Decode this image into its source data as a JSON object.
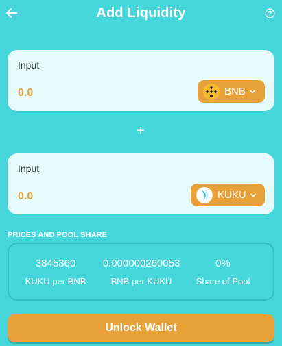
{
  "header": {
    "title": "Add Liquidity",
    "back_icon": "arrow-left-icon",
    "help_icon": "question-circle-icon"
  },
  "input_a": {
    "label": "Input",
    "value": "0.0",
    "token": "BNB",
    "token_icon": "bnb-logo-icon"
  },
  "plus_symbol": "+",
  "input_b": {
    "label": "Input",
    "value": "0.0",
    "token": "KUKU",
    "token_icon": "kuku-logo-icon"
  },
  "prices": {
    "section_title": "PRICES AND POOL SHARE",
    "items": [
      {
        "value": "3845360",
        "label": "KUKU per BNB"
      },
      {
        "value": "0.000000260053",
        "label": "BNB per KUKU"
      },
      {
        "value": "0%",
        "label": "Share of Pool"
      }
    ]
  },
  "action": {
    "label": "Unlock Wallet"
  },
  "colors": {
    "background": "#45d6dc",
    "card": "#e6fcfc",
    "accent": "#e8a138",
    "value_text": "#e5a03a",
    "pool_border": "#32bcc2"
  }
}
